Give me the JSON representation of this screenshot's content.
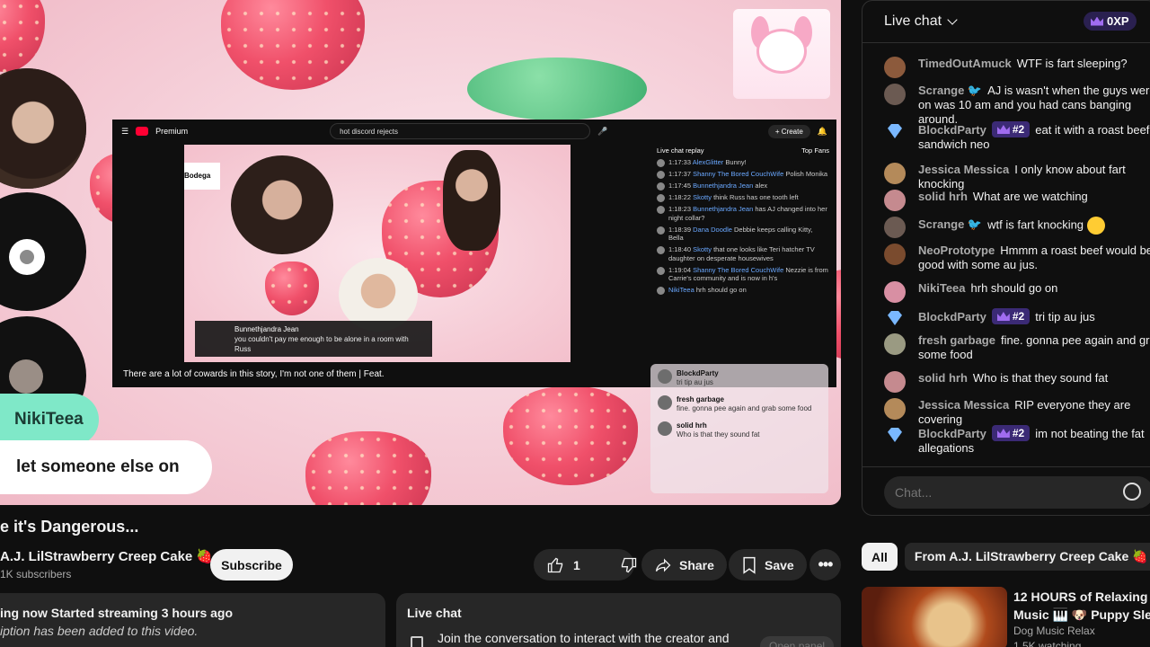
{
  "player": {
    "name_tag": "NikiTeea",
    "name_tag_message": "let someone else on",
    "embedded": {
      "search_query": "hot discord rejects",
      "premium_label": "Premium",
      "create_label": "Create",
      "caption": "There are a lot of cowards in this story, I'm not one of them | Feat.",
      "banner_name": "Bunnethjandra Jean",
      "banner_text": "you couldn't pay me enough to be alone in a room with Russ",
      "chat_header": "Live chat replay",
      "top_fans": "Top Fans",
      "chat": [
        {
          "time": "1:17:33",
          "name": "AlexGlitter",
          "text": "Bunny!"
        },
        {
          "time": "1:17:37",
          "name": "Shanny The Bored CouchWife",
          "text": "Polish Monika"
        },
        {
          "time": "1:17:45",
          "name": "Bunnethjandra Jean",
          "text": "alex"
        },
        {
          "time": "1:18:22",
          "name": "Skotty",
          "text": "think Russ has one tooth left"
        },
        {
          "time": "1:18:23",
          "name": "Bunnethjandra Jean",
          "text": "has AJ changed into her night collar?"
        },
        {
          "time": "1:18:39",
          "name": "Dana Doodle",
          "text": "Debbie keeps calling Kitty, Bella"
        },
        {
          "time": "1:18:40",
          "name": "Skotty",
          "text": "that one looks like Teri hatcher TV daughter on desperate housewives"
        },
        {
          "time": "1:19:04",
          "name": "Shanny The Bored CouchWife",
          "text": "Nezzie is from Carrie's community and is now in h's"
        },
        {
          "time": "",
          "name": "NikiTeea",
          "text": "hrh should go on"
        }
      ]
    },
    "overlay_chat": [
      {
        "name": "BlockdParty",
        "text": "tri tip au jus"
      },
      {
        "name": "fresh garbage",
        "text": "fine. gonna pee again and grab some food"
      },
      {
        "name": "solid hrh",
        "text": "Who is that they sound fat"
      }
    ]
  },
  "video": {
    "title": "e it's Dangerous...",
    "channel": "A.J. LilStrawberry Creep Cake 🍓",
    "subscribers": "1K subscribers",
    "subscribe_label": "Subscribe",
    "like_count": "1",
    "share_label": "Share",
    "save_label": "Save",
    "status_line": "ing now  Started streaming 3 hours ago",
    "desc_line": "iption has been added to this video.",
    "livechat_title": "Live chat",
    "livechat_text": "Join the conversation to interact with the creator and",
    "open_panel": "Open panel"
  },
  "chat": {
    "title": "Live chat",
    "xp": "0XP",
    "input_placeholder": "Chat...",
    "messages": [
      {
        "name": "TimedOutAmuck",
        "text": "WTF is fart sleeping?",
        "color": "#8c5a3c"
      },
      {
        "name": "Scrange 🐦",
        "text": "AJ is wasn't when the guys were on was 10 am and you had cans banging around.",
        "color": "#6b5a52"
      },
      {
        "name": "BlockdParty",
        "badge": "#2",
        "text": "eat it with a roast beef sandwich neo",
        "color": "diamond"
      },
      {
        "name": "Jessica Messica",
        "text": "I only know about fart knocking",
        "color": "#b48a5a"
      },
      {
        "name": "solid hrh",
        "text": "What are we watching",
        "color": "#c58a8f"
      },
      {
        "name": "Scrange 🐦",
        "text": "wtf is fart knocking",
        "color": "#6b5a52",
        "emoji": true
      },
      {
        "name": "NeoPrototype",
        "text": "Hmmm a roast beef would be good with some au jus.",
        "color": "#7a4b2e"
      },
      {
        "name": "NikiTeea",
        "text": "hrh should go on",
        "color": "#d88fa3"
      },
      {
        "name": "BlockdParty",
        "badge": "#2",
        "text": "tri tip au jus",
        "color": "diamond"
      },
      {
        "name": "fresh garbage",
        "text": "fine. gonna pee again and grab some food",
        "color": "#9a9a82"
      },
      {
        "name": "solid hrh",
        "text": "Who is that they sound fat",
        "color": "#c58a8f"
      },
      {
        "name": "Jessica Messica",
        "text": "RIP everyone they are covering",
        "color": "#b48a5a"
      },
      {
        "name": "BlockdParty",
        "badge": "#2",
        "text": "im not beating the fat allegations",
        "color": "diamond"
      }
    ]
  },
  "recs": {
    "chips": [
      "All",
      "From A.J. LilStrawberry Creep Cake 🍓"
    ],
    "item": {
      "title_line1": "12 HOURS of Relaxing Pia",
      "title_line2": "Music 🎹 🐶 Puppy Sleep",
      "channel": "Dog Music Relax",
      "views": "1.5K watching"
    }
  }
}
